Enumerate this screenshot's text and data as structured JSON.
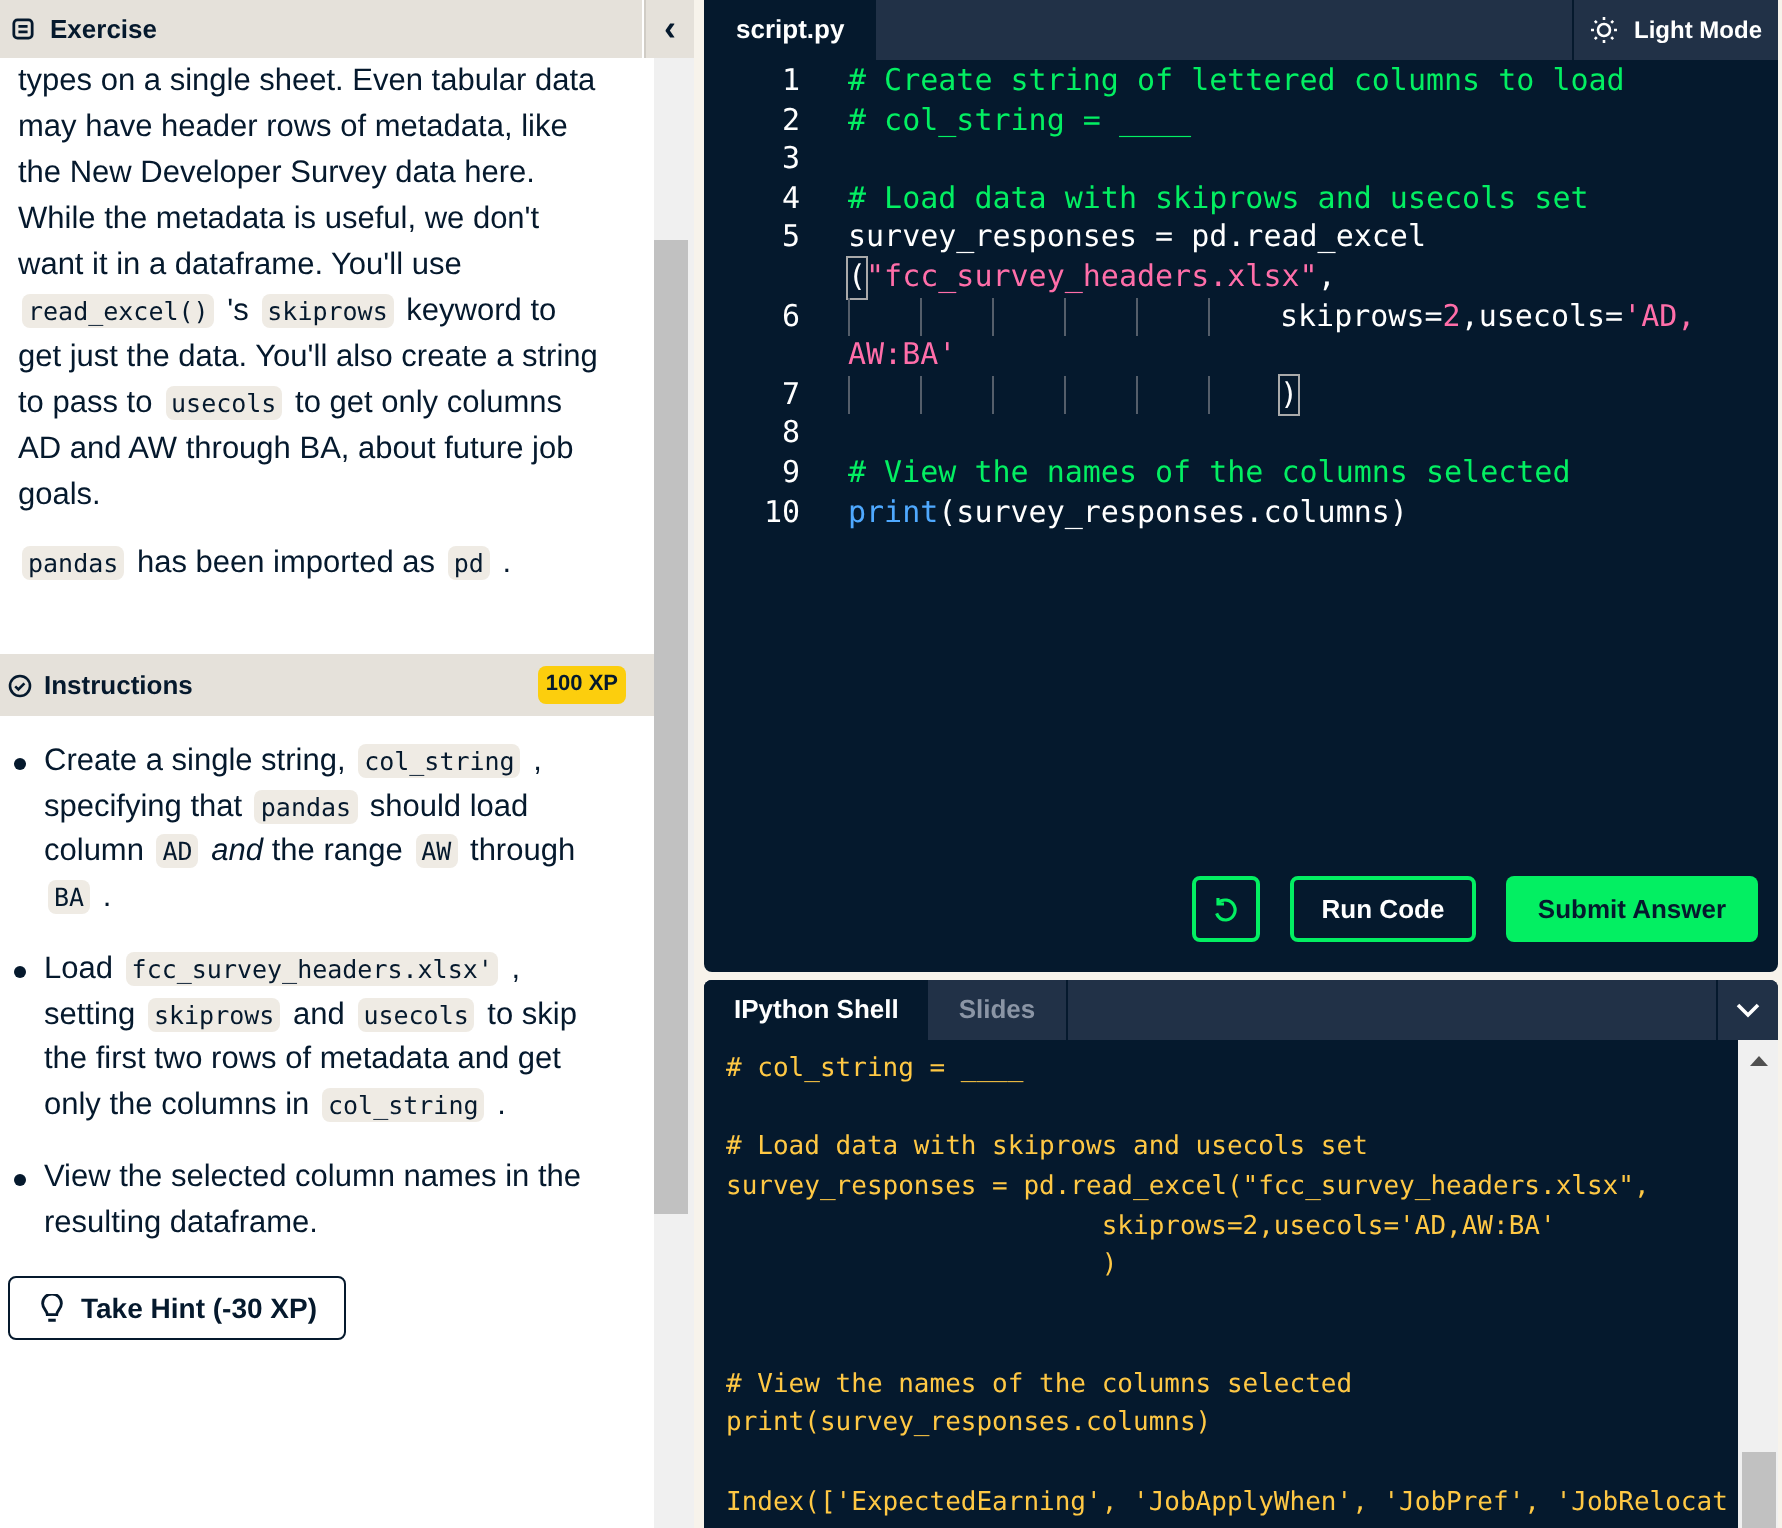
{
  "exercise": {
    "title": "Exercise",
    "collapse_icon": "‹",
    "paragraphs": [
      [
        {
          "kind": "text",
          "text": "types on a single sheet. Even tabular data may have header rows of metadata, like the New Developer Survey data here. While the metadata is useful, we don't want it in a dataframe. You'll use "
        },
        {
          "kind": "code",
          "text": "read_excel()"
        },
        {
          "kind": "text",
          "text": " 's "
        },
        {
          "kind": "code",
          "text": "skiprows"
        },
        {
          "kind": "text",
          "text": " keyword to get just the data. You'll also create a string to pass to "
        },
        {
          "kind": "code",
          "text": "usecols"
        },
        {
          "kind": "text",
          "text": " to get only columns AD and AW through BA, about future job goals."
        }
      ],
      [
        {
          "kind": "code",
          "text": "pandas"
        },
        {
          "kind": "text",
          "text": " has been imported as "
        },
        {
          "kind": "code",
          "text": "pd"
        },
        {
          "kind": "text",
          "text": " ."
        }
      ]
    ]
  },
  "instructions": {
    "title": "Instructions",
    "xp": "100 XP",
    "items": [
      [
        {
          "kind": "text",
          "text": "Create a single string, "
        },
        {
          "kind": "code",
          "text": "col_string"
        },
        {
          "kind": "text",
          "text": " , specifying that "
        },
        {
          "kind": "code",
          "text": "pandas"
        },
        {
          "kind": "text",
          "text": " should load column "
        },
        {
          "kind": "code",
          "text": "AD"
        },
        {
          "kind": "text",
          "text": " *and* the range "
        },
        {
          "kind": "code",
          "text": "AW"
        },
        {
          "kind": "text",
          "text": " through "
        },
        {
          "kind": "code",
          "text": "BA"
        },
        {
          "kind": "text",
          "text": " ."
        }
      ],
      [
        {
          "kind": "text",
          "text": "Load "
        },
        {
          "kind": "code",
          "text": "fcc_survey_headers.xlsx'"
        },
        {
          "kind": "text",
          "text": " , setting "
        },
        {
          "kind": "code",
          "text": "skiprows"
        },
        {
          "kind": "text",
          "text": " and "
        },
        {
          "kind": "code",
          "text": "usecols"
        },
        {
          "kind": "text",
          "text": " to skip the first two rows of metadata and get only the columns in "
        },
        {
          "kind": "code",
          "text": "col_string"
        },
        {
          "kind": "text",
          "text": " ."
        }
      ],
      [
        {
          "kind": "text",
          "text": "View the selected column names in the resulting dataframe."
        }
      ]
    ],
    "hint_button": "Take Hint (-30 XP)"
  },
  "editor": {
    "tab": "script.py",
    "mode_button": "Light Mode",
    "rows": [
      {
        "number": "1",
        "tokens": [
          {
            "kind": "comment",
            "text": "# Create string of lettered columns to load"
          }
        ]
      },
      {
        "number": "2",
        "tokens": [
          {
            "kind": "comment",
            "text": "# col_string = ____"
          }
        ]
      },
      {
        "number": "3",
        "tokens": []
      },
      {
        "number": "4",
        "tokens": [
          {
            "kind": "comment",
            "text": "# Load data with skiprows and usecols set"
          }
        ]
      },
      {
        "number": "5",
        "tokens": [
          {
            "kind": "plain",
            "text": "survey_responses = pd.read_excel"
          }
        ]
      },
      {
        "tokens": [
          {
            "kind": "bracket",
            "text": "("
          },
          {
            "kind": "string",
            "text": "\"fcc_survey_headers.xlsx\""
          },
          {
            "kind": "plain",
            "text": ","
          }
        ]
      },
      {
        "number": "6",
        "guides": true,
        "tokens": [
          {
            "kind": "plain",
            "text": "skiprows="
          },
          {
            "kind": "number",
            "text": "2"
          },
          {
            "kind": "plain",
            "text": ",usecols="
          },
          {
            "kind": "string",
            "text": "'AD,"
          }
        ]
      },
      {
        "tokens": [
          {
            "kind": "string",
            "text": "AW:BA'"
          }
        ]
      },
      {
        "number": "7",
        "guides": true,
        "tokens": [
          {
            "kind": "bracket",
            "text": ")"
          }
        ]
      },
      {
        "number": "8",
        "tokens": []
      },
      {
        "number": "9",
        "tokens": [
          {
            "kind": "comment",
            "text": "# View the names of the columns selected"
          }
        ]
      },
      {
        "number": "10",
        "tokens": [
          {
            "kind": "builtin",
            "text": "print"
          },
          {
            "kind": "plain",
            "text": "(survey_responses.columns)"
          }
        ]
      }
    ],
    "buttons": [
      {
        "kind": "reset"
      },
      {
        "kind": "outline",
        "label": "Run Code"
      },
      {
        "kind": "primary",
        "label": "Submit Answer"
      }
    ]
  },
  "shell": {
    "tabs": [
      {
        "label": "IPython Shell",
        "selected": true
      },
      {
        "label": "Slides",
        "selected": false
      }
    ],
    "blocks": [
      {
        "kind": "top",
        "lines": [
          "# col_string = ____"
        ]
      },
      {
        "kind": "spaced",
        "lines": [
          "# Load data with skiprows and usecols set",
          "survey_responses = pd.read_excel(\"fcc_survey_headers.xlsx\",",
          "                        skiprows=2,usecols='AD,AW:BA'",
          "                        )"
        ]
      },
      {
        "kind": "widespaced",
        "lines": [
          "# View the names of the columns selected",
          "print(survey_responses.columns)"
        ]
      },
      {
        "kind": "spaced",
        "lines": [
          "Index(['ExpectedEarning', 'JobApplyWhen', 'JobPref', 'JobRelocat"
        ]
      }
    ]
  }
}
